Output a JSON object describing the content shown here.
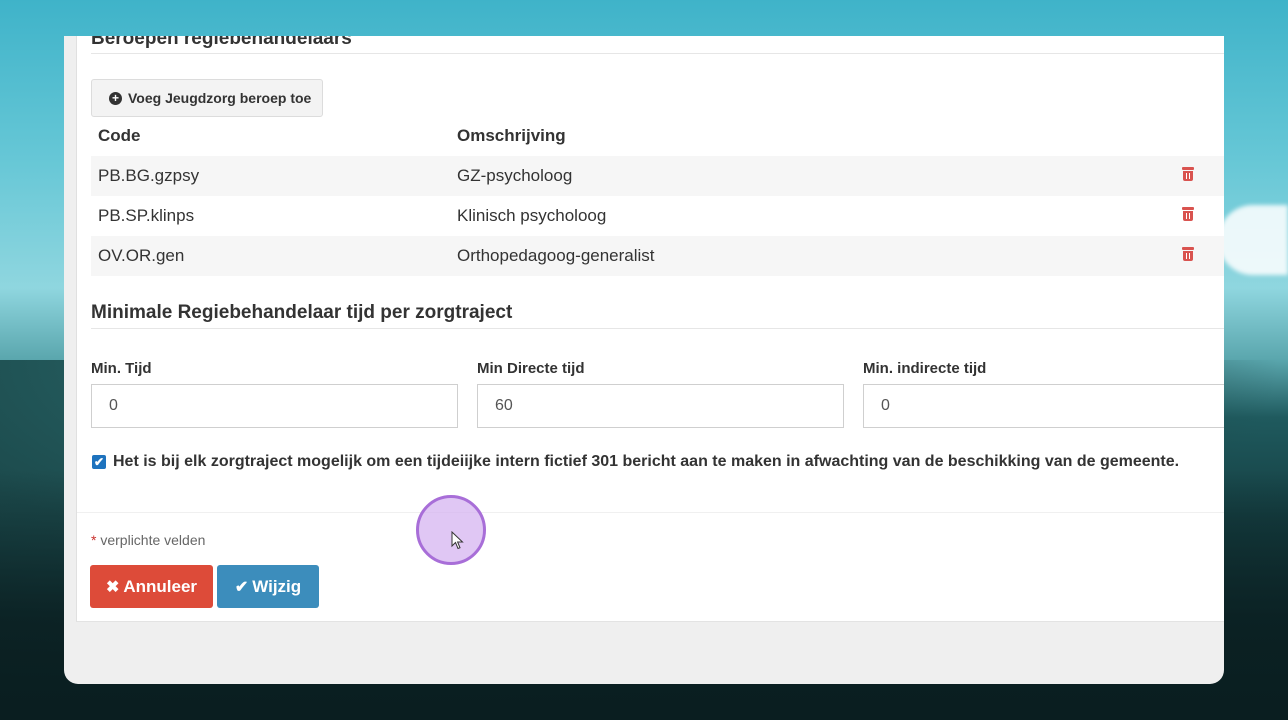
{
  "section1": {
    "title": "Beroepen regiebehandelaars",
    "add_button_label": "Voeg Jeugdzorg beroep toe"
  },
  "table": {
    "headers": {
      "code": "Code",
      "description": "Omschrijving"
    },
    "rows": [
      {
        "code": "PB.BG.gzpsy",
        "description": "GZ-psycholoog"
      },
      {
        "code": "PB.SP.klinps",
        "description": "Klinisch psycholoog"
      },
      {
        "code": "OV.OR.gen",
        "description": "Orthopedagoog-generalist"
      }
    ]
  },
  "section2": {
    "title": "Minimale Regiebehandelaar tijd per zorgtraject",
    "fields": [
      {
        "label": "Min. Tijd",
        "value": "0"
      },
      {
        "label": "Min Directe tijd",
        "value": "60"
      },
      {
        "label": "Min. indirecte tijd",
        "value": "0"
      }
    ],
    "checkbox_label": "Het is bij elk zorgtraject mogelijk om een tijdeiijke intern fictief 301 bericht aan te maken in afwachting van de beschikking van de gemeente.",
    "checkbox_checked": true
  },
  "footer": {
    "required_star": "*",
    "required_text": "verplichte velden",
    "cancel_label": "Annuleer",
    "submit_label": "Wijzig"
  },
  "colors": {
    "cancel": "#dd4b39",
    "submit": "#3c8dbc",
    "delete_icon": "#d9534f",
    "checkbox": "#1e73be"
  },
  "icons": {
    "add": "plus-circle-icon",
    "delete": "trash-icon",
    "cancel": "times-icon",
    "submit": "check-icon"
  }
}
